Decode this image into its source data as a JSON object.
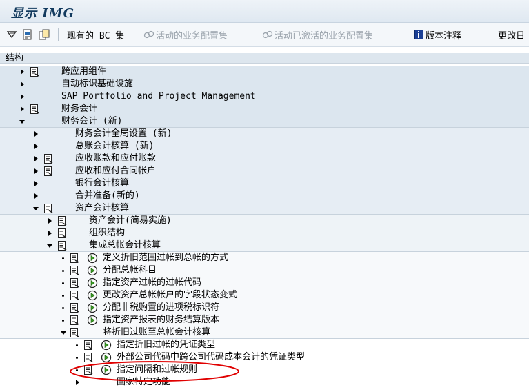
{
  "window": {
    "title": "显示 IMG"
  },
  "toolbar": {
    "existing_bc_label": "现有的 BC 集",
    "active_bc_label": "活动的业务配置集",
    "active_activated_label": "活动已激活的业务配置集",
    "release_notes_label": "版本注释",
    "changes_label": "更改日"
  },
  "structure": {
    "header": "结构"
  },
  "tree": {
    "items": [
      {
        "label": "跨应用组件"
      },
      {
        "label": "自动标识基础设施"
      },
      {
        "label": "SAP Portfolio and Project Management"
      },
      {
        "label": "财务会计"
      },
      {
        "label": "财务会计 (新)"
      },
      {
        "label": "财务会计全局设置 (新)"
      },
      {
        "label": "总账会计核算 (新)"
      },
      {
        "label": "应收账款和应付账款"
      },
      {
        "label": "应收和应付合同帐户"
      },
      {
        "label": "银行会计核算"
      },
      {
        "label": "合并准备(新的)"
      },
      {
        "label": "资产会计核算"
      },
      {
        "label": "资产会计(简易实施)"
      },
      {
        "label": "组织结构"
      },
      {
        "label": "集成总帐会计核算"
      },
      {
        "label": "定义折旧范围过帐到总帐的方式"
      },
      {
        "label": "分配总帐科目"
      },
      {
        "label": "指定资产过帐的过帐代码"
      },
      {
        "label": "更改资产总帐帐户的字段状态变式"
      },
      {
        "label": "分配非税购置的进项税标识符"
      },
      {
        "label": "指定资产报表的财务结算版本"
      },
      {
        "label": "将折旧过账至总帐会计核算"
      },
      {
        "label": "指定折旧过帐的凭证类型"
      },
      {
        "label": "外部公司代码中跨公司代码成本会计的凭证类型"
      },
      {
        "label": "指定间隔和过帐规则"
      },
      {
        "label": "国家特定功能"
      }
    ]
  },
  "colors": {
    "highlight_ellipse": "#e00000",
    "title": "#123a5e"
  }
}
